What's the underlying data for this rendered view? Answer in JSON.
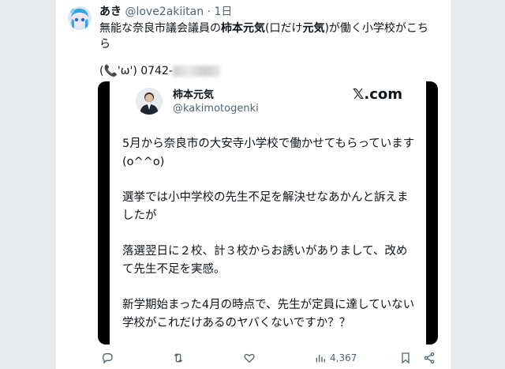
{
  "tweet": {
    "author_name": "あき",
    "author_handle": "@love2akiitan",
    "separator": "·",
    "time": "1日",
    "text_parts": [
      {
        "text": "無能な奈良市議会議員の",
        "bold": false
      },
      {
        "text": "柿本元気",
        "bold": true
      },
      {
        "text": "(口だけ",
        "bold": false
      },
      {
        "text": "元気",
        "bold": true
      },
      {
        "text": ")が働く小学校がこちら",
        "bold": false
      }
    ],
    "phone_prefix": "(📞'ω') 0742-",
    "avatar_icon": "anime-avatar-icon"
  },
  "card": {
    "name": "柿本元気",
    "handle": "@kakimotogenki",
    "logo": "𝕏.com",
    "paragraphs": [
      "5月から奈良市の大安寺小学校で働かせてもらっています(o^^o)",
      "選挙では小中学校の先生不足を解決せなあかんと訴えましたが",
      "落選翌日に２校、計３校からお誘いがありまして、改めて先生不足を実感。",
      "新学期始まった4月の時点で、先生が定員に達していない学校がこれだけあるのヤバくないですか？？"
    ]
  },
  "actions": {
    "reply_icon": "reply-icon",
    "retweet_icon": "retweet-icon",
    "like_icon": "heart-icon",
    "views_icon": "views-icon",
    "views_count": "4,367",
    "bookmark_icon": "bookmark-icon",
    "share_icon": "share-icon"
  },
  "colors": {
    "text": "#0f1419",
    "secondary": "#536471",
    "media_bg": "#000000"
  }
}
